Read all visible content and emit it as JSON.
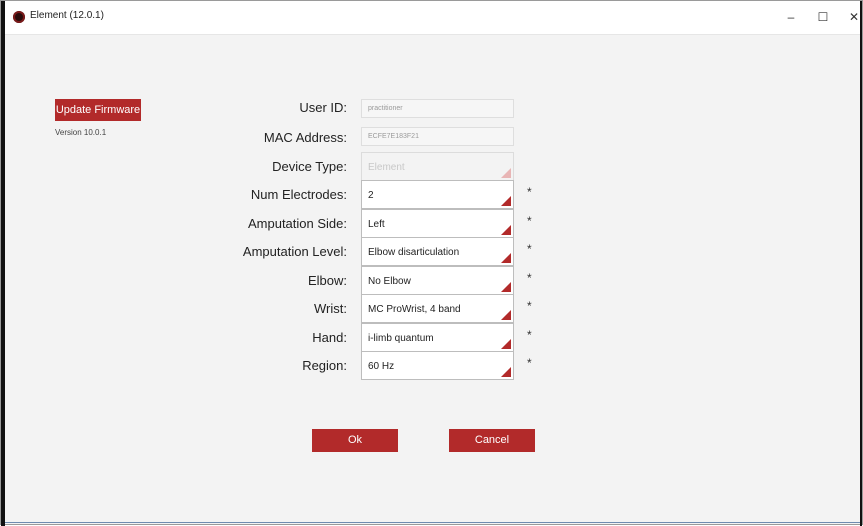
{
  "window": {
    "title": "Element (12.0.1)",
    "minimize_glyph": "–",
    "maximize_glyph": "☐",
    "close_glyph": "✕"
  },
  "sidebar": {
    "update_firmware_label": "Update Firmware",
    "version_text": "Version 10.0.1"
  },
  "form": {
    "user_id": {
      "label": "User ID:",
      "value": "practitioner"
    },
    "mac_address": {
      "label": "MAC Address:",
      "value": "ECFE7E183F21"
    },
    "device_type": {
      "label": "Device Type:",
      "value": "Element"
    },
    "num_electrodes": {
      "label": "Num Electrodes:",
      "value": "2",
      "required": "*"
    },
    "amputation_side": {
      "label": "Amputation Side:",
      "value": "Left",
      "required": "*"
    },
    "amputation_level": {
      "label": "Amputation Level:",
      "value": "Elbow disarticulation",
      "required": "*"
    },
    "elbow": {
      "label": "Elbow:",
      "value": "No Elbow",
      "required": "*"
    },
    "wrist": {
      "label": "Wrist:",
      "value": "MC ProWrist, 4 band",
      "required": "*"
    },
    "hand": {
      "label": "Hand:",
      "value": "i-limb quantum",
      "required": "*"
    },
    "region": {
      "label": "Region:",
      "value": "60 Hz",
      "required": "*"
    }
  },
  "actions": {
    "ok_label": "Ok",
    "cancel_label": "Cancel"
  },
  "colors": {
    "accent": "#b22a2a",
    "background": "#f3f3f3"
  }
}
